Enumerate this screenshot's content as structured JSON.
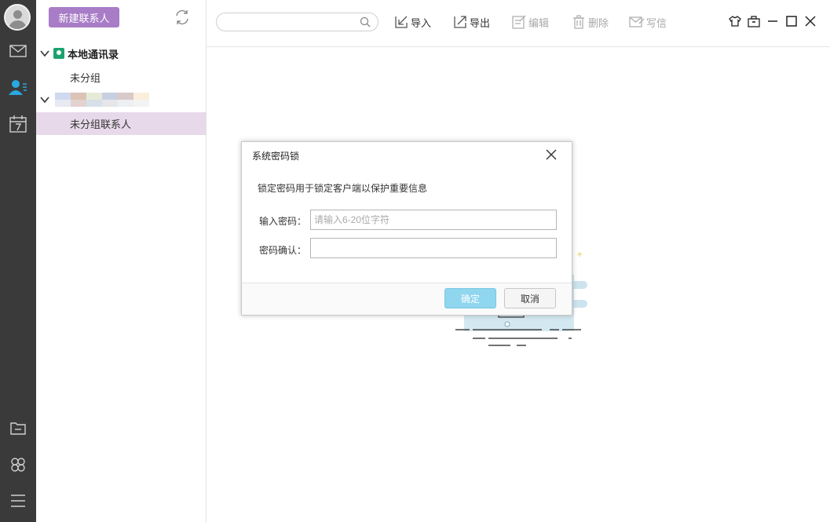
{
  "sidebar": {
    "new_contact_label": "新建联系人",
    "local_book_label": "本地通讯录",
    "local_group_label": "未分组",
    "account_group_label": "未分组联系人"
  },
  "toolbar": {
    "search_placeholder": "",
    "import_label": "导入",
    "export_label": "导出",
    "edit_label": "编辑",
    "delete_label": "删除",
    "write_label": "写信"
  },
  "dialog": {
    "title": "系统密码锁",
    "description": "锁定密码用于锁定客户端以保护重要信息",
    "password_label": "输入密码：",
    "password_placeholder": "请输入6-20位字符",
    "confirm_label": "密码确认：",
    "ok_label": "确定",
    "cancel_label": "取消"
  },
  "colors": {
    "rail_bg": "#3a3a3a",
    "accent_purple": "#a87cc6",
    "selected_row": "#e7d9ea",
    "ok_button": "#8fd6ee",
    "active_icon": "#2aa8e0"
  },
  "icons": {
    "rail": [
      "avatar",
      "mail-icon",
      "contacts-icon",
      "calendar-icon",
      "folder-icon",
      "apps-icon",
      "menu-icon"
    ],
    "window": [
      "skin-icon",
      "briefcase-icon",
      "minimize-icon",
      "maximize-icon",
      "close-icon"
    ]
  }
}
